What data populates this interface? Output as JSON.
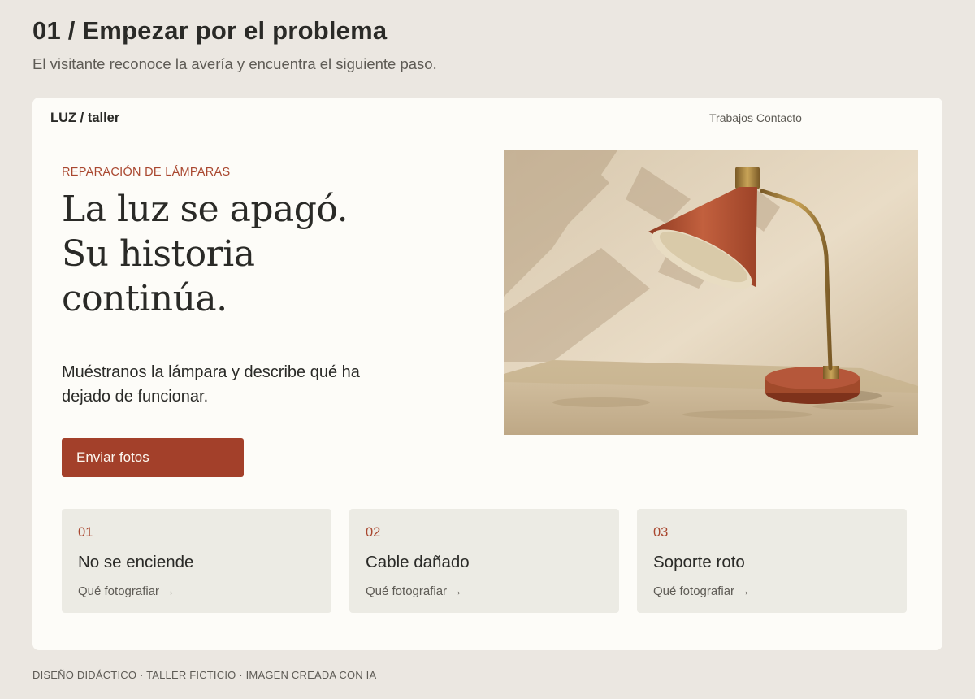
{
  "header": {
    "title": "01 / Empezar por el problema",
    "subtitle": "El visitante reconoce la avería y encuentra el siguiente paso."
  },
  "site": {
    "brand": "LUZ / taller",
    "nav": [
      "Trabajos",
      "Contacto"
    ],
    "hero": {
      "eyebrow": "REPARACIÓN DE LÁMPARAS",
      "headline": [
        "La luz se apagó.",
        "Su historia",
        "continúa."
      ],
      "lede": "Muéstranos la lámpara y describe qué ha dejado de funcionar.",
      "cta_label": "Enviar fotos",
      "image_icon": "desk-lamp-photo"
    },
    "cards": [
      {
        "num": "01",
        "title": "No se enciende",
        "link": "Qué fotografiar →"
      },
      {
        "num": "02",
        "title": "Cable dañado",
        "link": "Qué fotografiar →"
      },
      {
        "num": "03",
        "title": "Soporte roto",
        "link": "Qué fotografiar →"
      }
    ]
  },
  "footer": {
    "text": "DISEÑO DIDÁCTICO · TALLER FICTICIO · IMAGEN CREADA CON IA"
  },
  "colors": {
    "background": "#ebe7e1",
    "surface": "#fdfcf8",
    "accent": "#a3402a",
    "accent_text": "#a9472f",
    "card": "#ecebe4"
  }
}
